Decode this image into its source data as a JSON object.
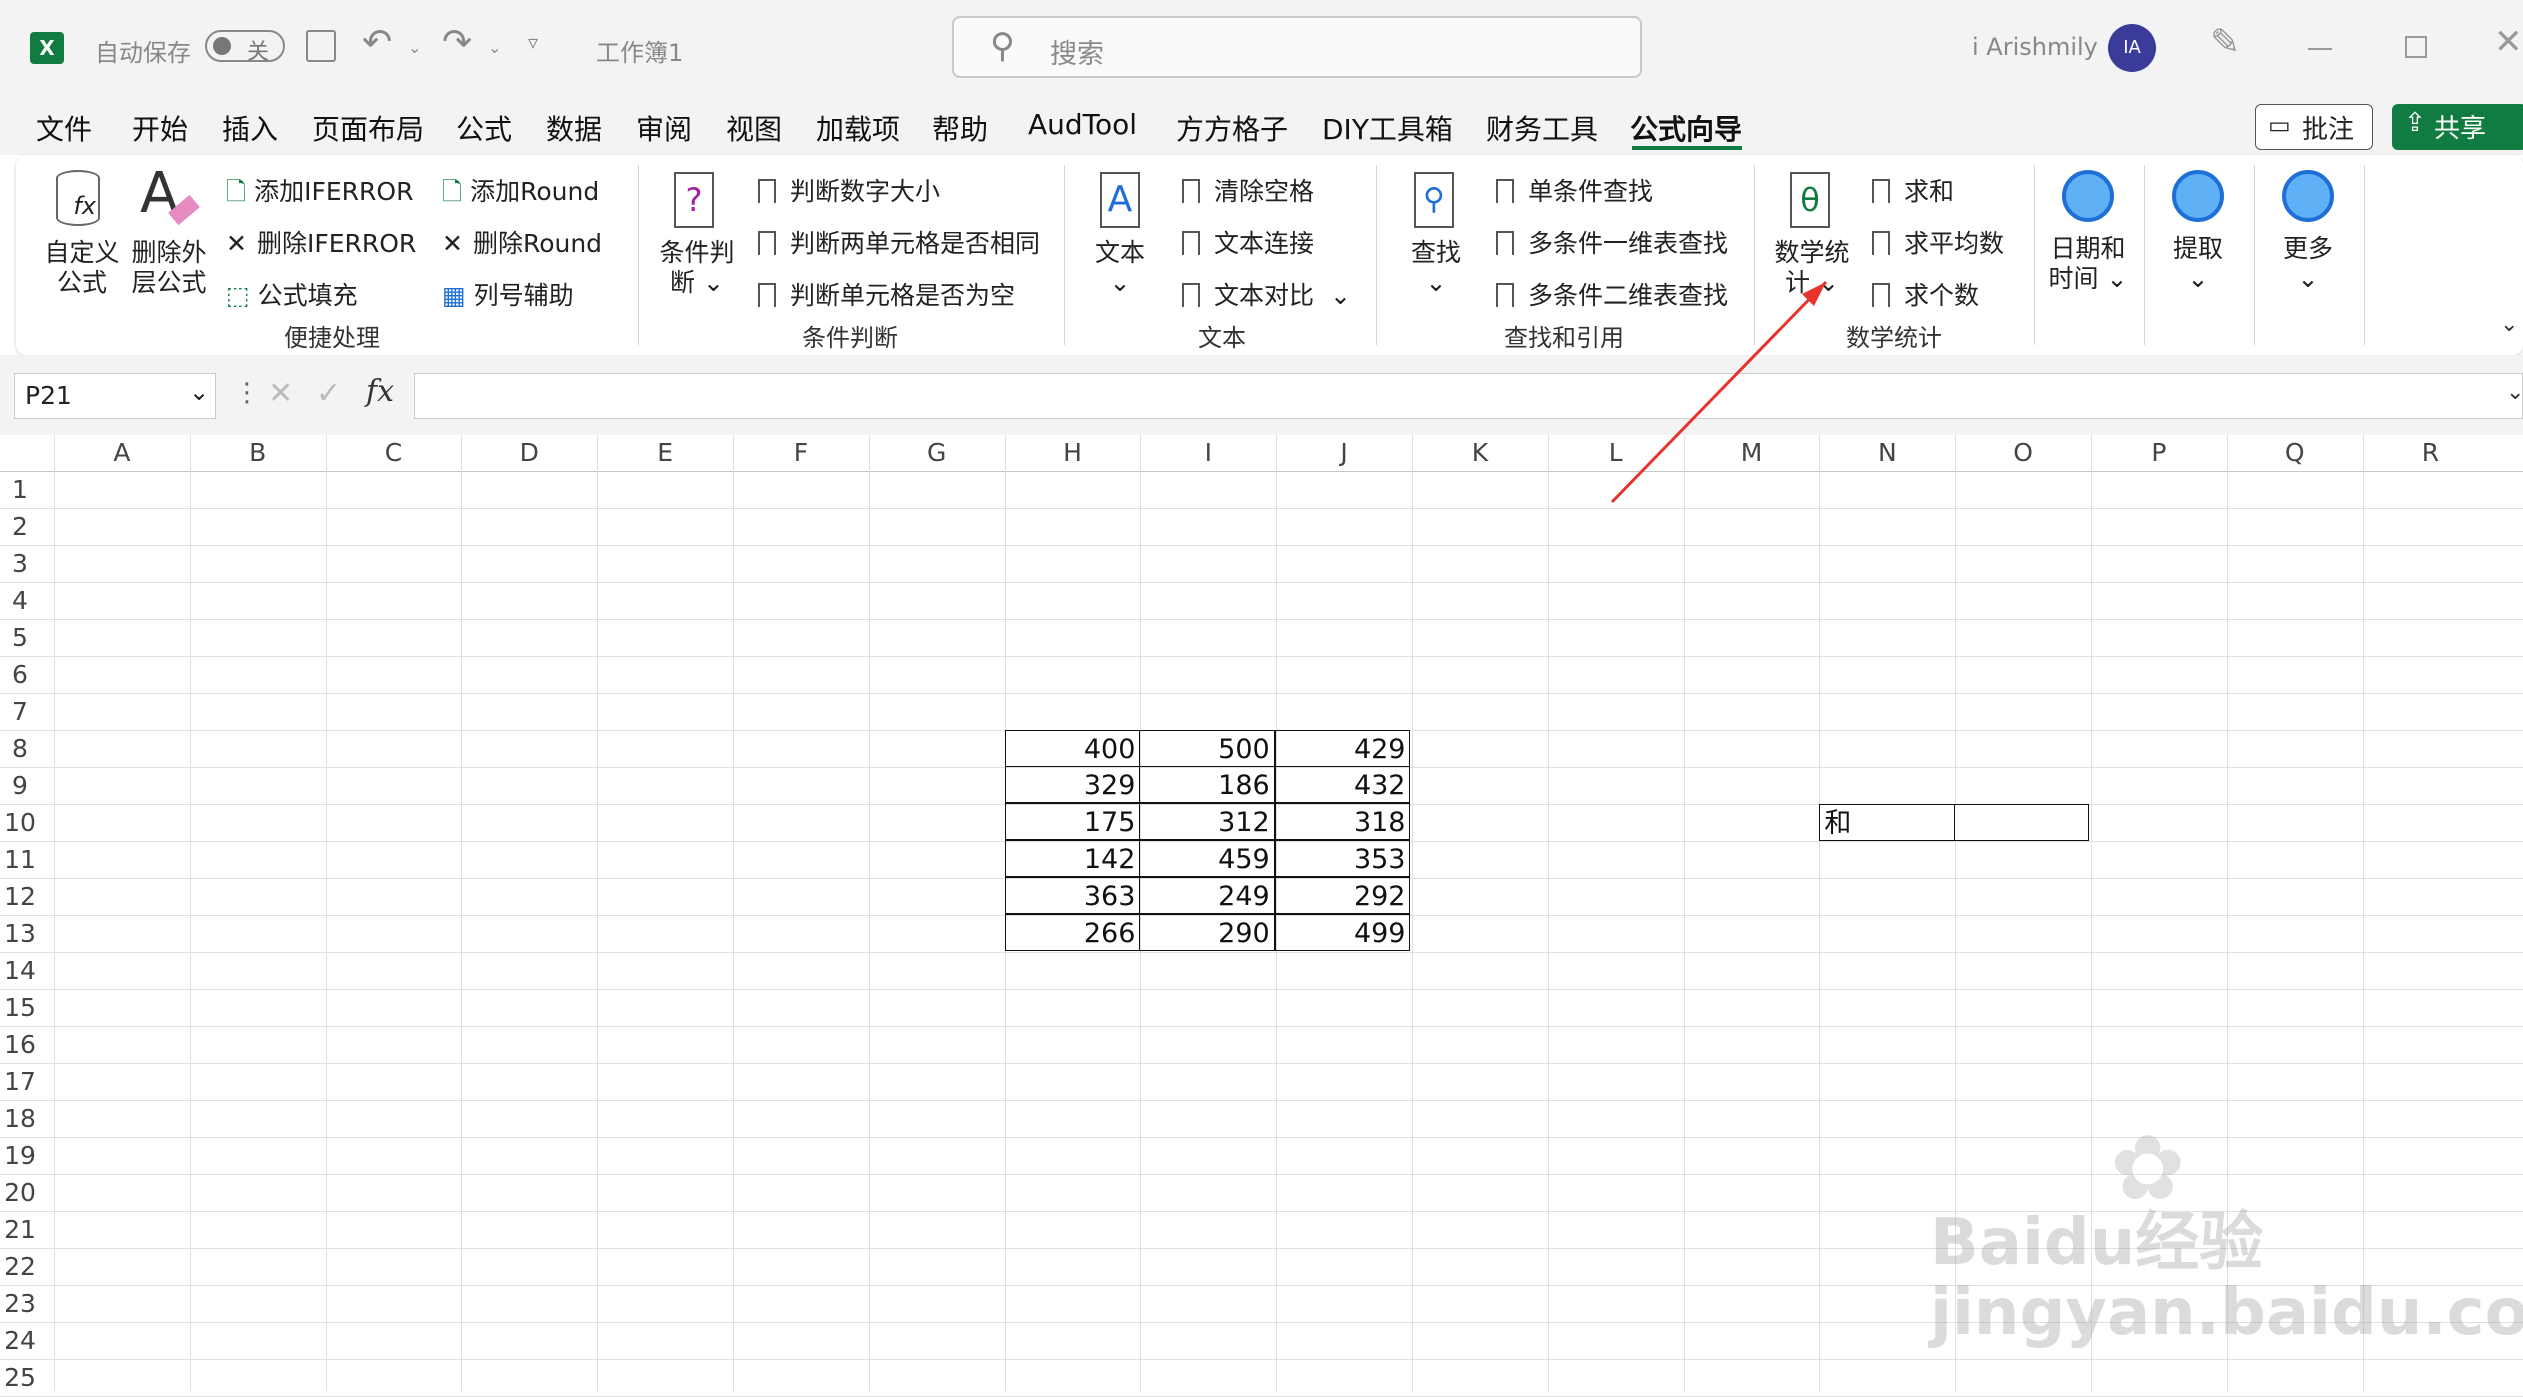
{
  "title_bar": {
    "autosave_label": "自动保存",
    "autosave_state": "关",
    "doc_title": "工作簿1",
    "search_placeholder": "搜索",
    "user_name": "i Arishmily",
    "avatar_initials": "IA"
  },
  "menu": {
    "tabs": [
      "文件",
      "开始",
      "插入",
      "页面布局",
      "公式",
      "数据",
      "审阅",
      "视图",
      "加载项",
      "帮助",
      "AudTool",
      "方方格子",
      "DIY工具箱",
      "财务工具",
      "公式向导"
    ],
    "active_tab": "公式向导",
    "comment_button": "批注",
    "share_button": "共享"
  },
  "ribbon": {
    "g1": {
      "label": "便捷处理",
      "custom_formula": "自定义公式",
      "remove_outer": "删除外层公式",
      "add_iferror": "添加IFERROR",
      "del_iferror": "删除IFERROR",
      "fill_formula": "公式填充",
      "add_round": "添加Round",
      "del_round": "删除Round",
      "col_helper": "列号辅助"
    },
    "g2": {
      "label": "条件判断",
      "big": "条件判断",
      "i1": "判断数字大小",
      "i2": "判断两单元格是否相同",
      "i3": "判断单元格是否为空"
    },
    "g3": {
      "label": "文本",
      "big": "文本",
      "i1": "清除空格",
      "i2": "文本连接",
      "i3": "文本对比"
    },
    "g4": {
      "label": "查找和引用",
      "big": "查找",
      "i1": "单条件查找",
      "i2": "多条件一维表查找",
      "i3": "多条件二维表查找"
    },
    "g5": {
      "label": "数学统计",
      "big": "数学统计",
      "i1": "求和",
      "i2": "求平均数",
      "i3": "求个数"
    },
    "date_time": "日期和时间",
    "extract": "提取",
    "more": "更多"
  },
  "formula_bar": {
    "name_box": "P21",
    "fx": "fx",
    "value": ""
  },
  "columns": [
    "A",
    "B",
    "C",
    "D",
    "E",
    "F",
    "G",
    "H",
    "I",
    "J",
    "K",
    "L",
    "M",
    "N",
    "O",
    "P",
    "Q",
    "R"
  ],
  "rows": [
    "1",
    "2",
    "3",
    "4",
    "5",
    "6",
    "7",
    "8",
    "9",
    "10",
    "11",
    "12",
    "13",
    "14",
    "15",
    "16",
    "17",
    "18",
    "19",
    "20",
    "21",
    "22",
    "23",
    "24",
    "25"
  ],
  "table": [
    [
      "400",
      "500",
      "429"
    ],
    [
      "329",
      "186",
      "432"
    ],
    [
      "175",
      "312",
      "318"
    ],
    [
      "142",
      "459",
      "353"
    ],
    [
      "363",
      "249",
      "292"
    ],
    [
      "266",
      "290",
      "499"
    ]
  ],
  "sum_cell": {
    "label": "和",
    "value": ""
  },
  "watermark": "Baidu经验 jingyan.baidu.com",
  "annotation_arrow_color": "#e8322e"
}
